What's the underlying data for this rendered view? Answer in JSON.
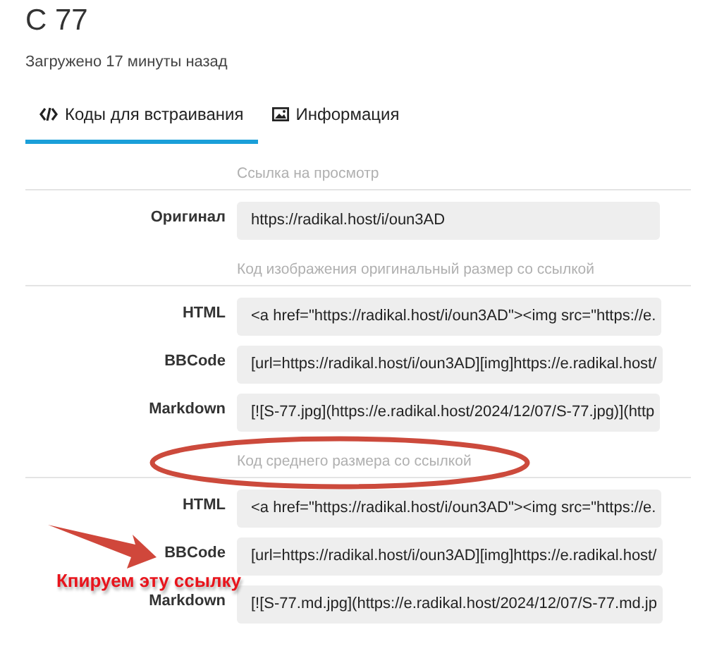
{
  "title": "С 77",
  "subtitle": "Загружено 17 минуты назад",
  "tabs": [
    {
      "label": "Коды для встраивания",
      "kind": "code",
      "selected": true
    },
    {
      "label": "Информация",
      "kind": "image",
      "selected": false
    }
  ],
  "sections": [
    {
      "heading": "Ссылка на просмотр",
      "circled": false,
      "rows": [
        {
          "label": "Оригинал",
          "value": "https://radikal.host/i/oun3AD"
        }
      ]
    },
    {
      "heading": "Код изображения оригинальный размер со ссылкой",
      "circled": false,
      "rows": [
        {
          "label": "HTML",
          "value": "<a href=\"https://radikal.host/i/oun3AD\"><img src=\"https://e."
        },
        {
          "label": "BBCode",
          "value": "[url=https://radikal.host/i/oun3AD][img]https://e.radikal.host/"
        },
        {
          "label": "Markdown",
          "value": "[![S-77.jpg](https://e.radikal.host/2024/12/07/S-77.jpg)](http"
        }
      ]
    },
    {
      "heading": "Код среднего размера со ссылкой",
      "circled": true,
      "rows": [
        {
          "label": "HTML",
          "value": "<a href=\"https://radikal.host/i/oun3AD\"><img src=\"https://e."
        },
        {
          "label": "BBCode",
          "value": "[url=https://radikal.host/i/oun3AD][img]https://e.radikal.host/"
        },
        {
          "label": "Markdown",
          "value": "[![S-77.md.jpg](https://e.radikal.host/2024/12/07/S-77.md.jp"
        }
      ]
    }
  ],
  "annotation": {
    "text": "Кпируем эту ссылку"
  }
}
